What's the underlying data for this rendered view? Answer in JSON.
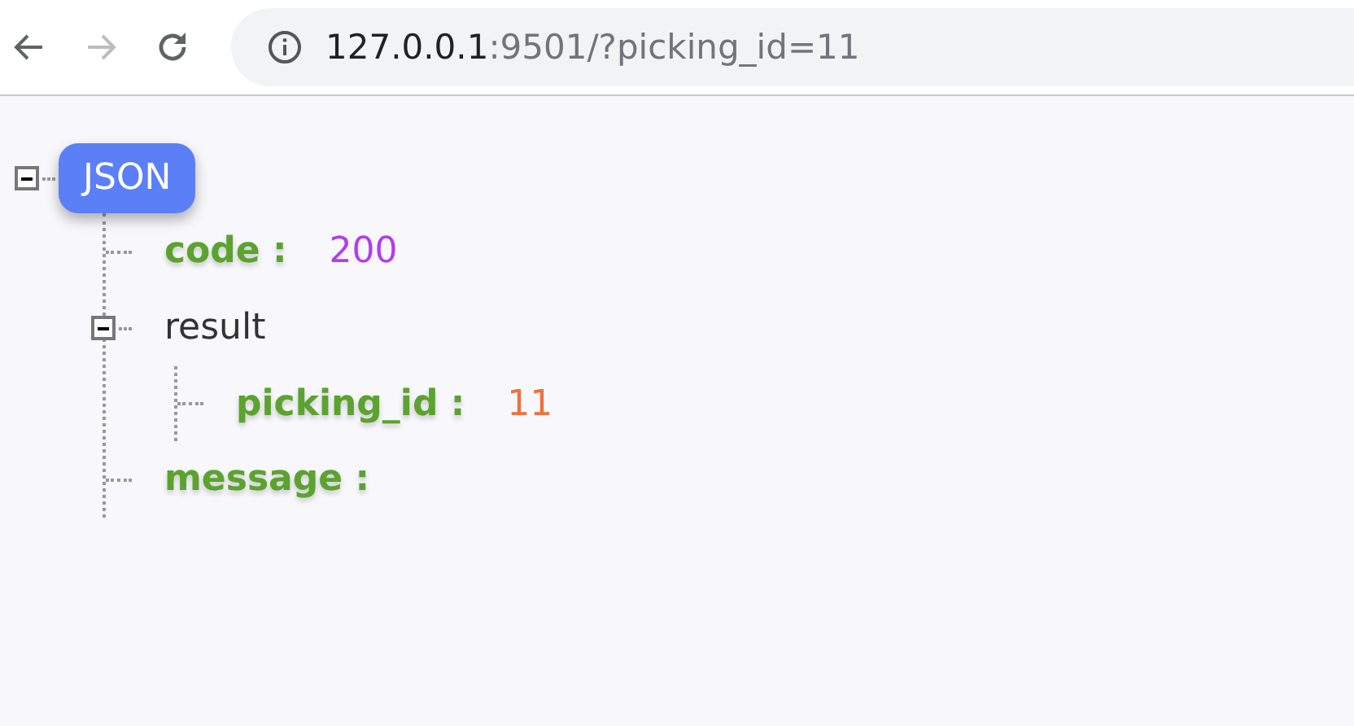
{
  "toolbar": {
    "back": {
      "disabled": false
    },
    "forward": {
      "disabled": true
    },
    "address": {
      "host": "127.0.0.1",
      "rest": ":9501/?picking_id=11"
    }
  },
  "tree": {
    "label": "JSON",
    "expanded": true,
    "children": [
      {
        "key": "code :",
        "value": "200",
        "color": "#b23cf0"
      },
      {
        "key": "result",
        "expanded": true,
        "children": [
          {
            "key": "picking_id :",
            "value": "11",
            "color": "#f0703c"
          }
        ]
      },
      {
        "key": "message :"
      }
    ]
  }
}
